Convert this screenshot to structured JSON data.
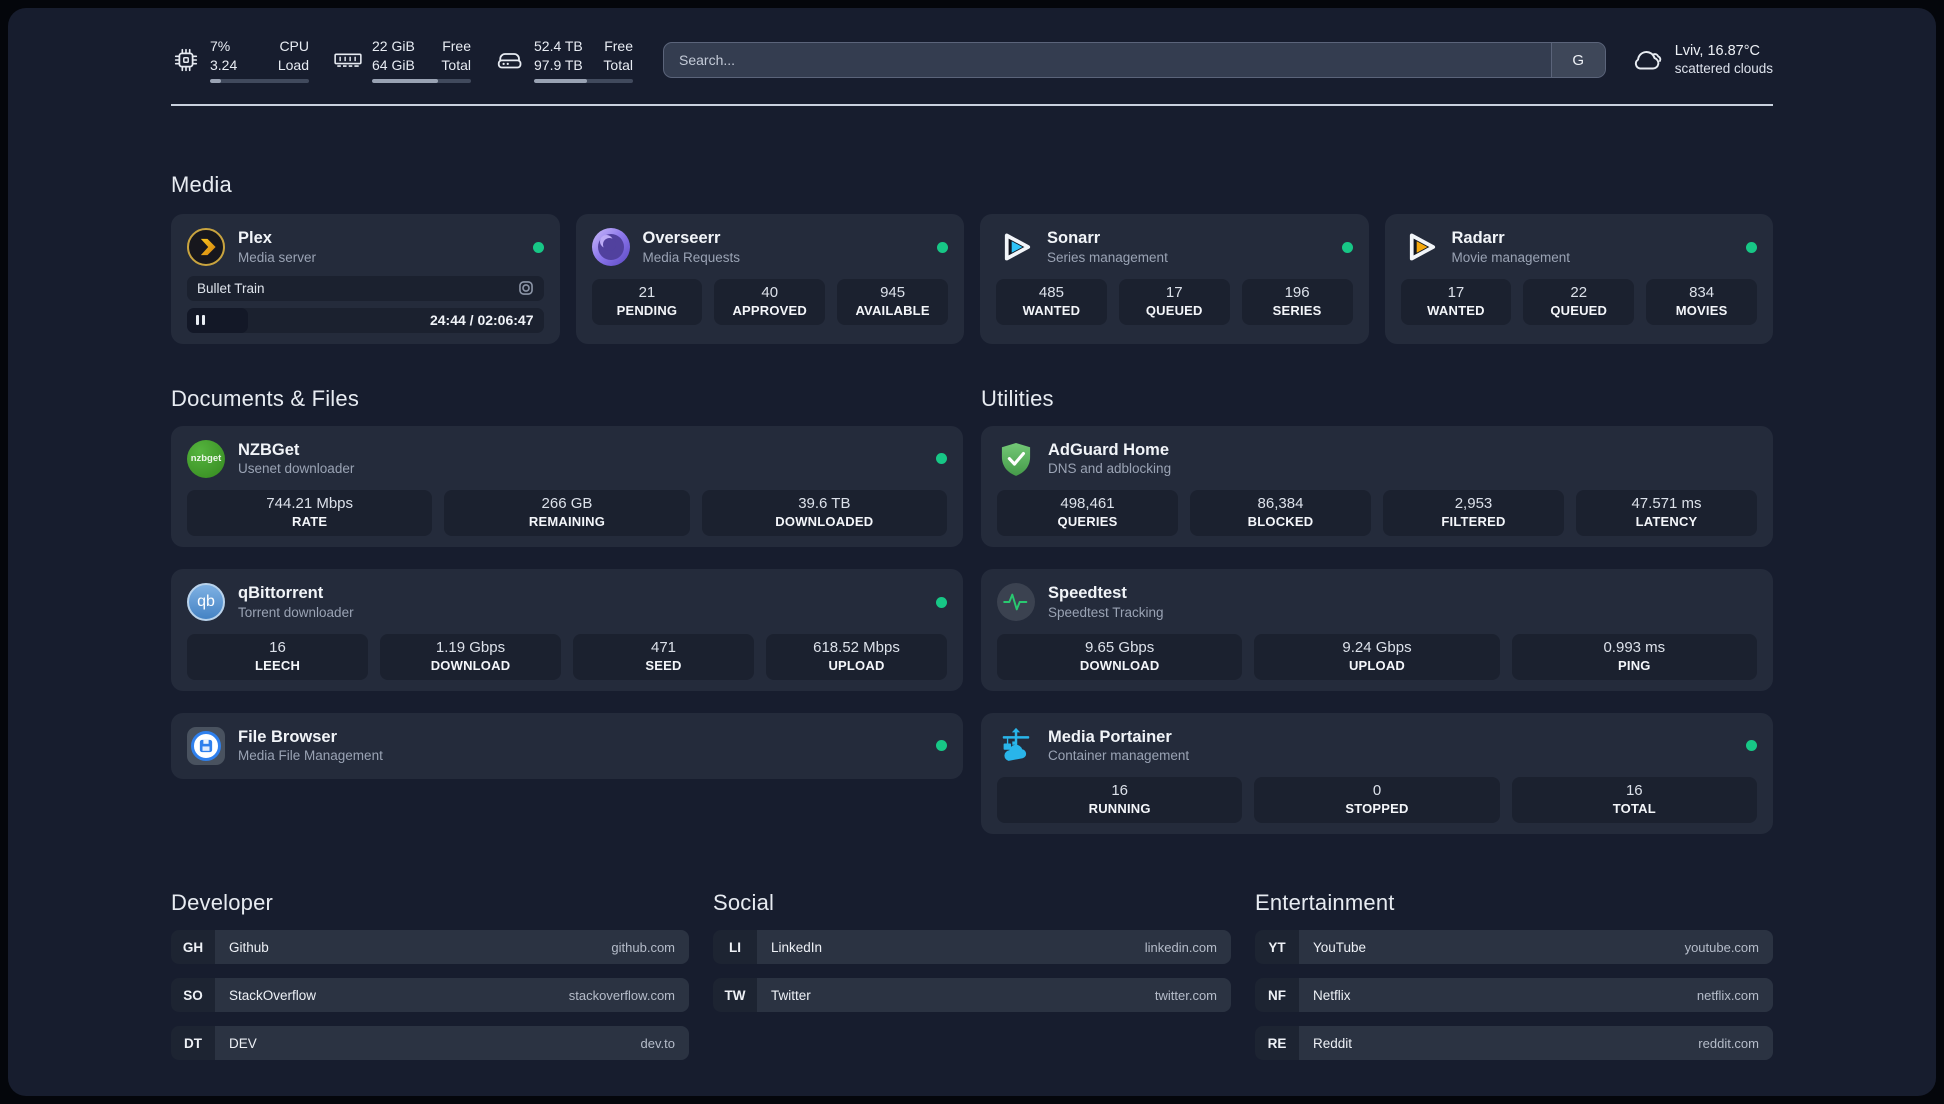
{
  "topbar": {
    "cpu": {
      "value_top": "7%",
      "value_bottom": "3.24",
      "label_top": "CPU",
      "label_bottom": "Load",
      "bar_css": "width:11%"
    },
    "memory": {
      "value_top": "22 GiB",
      "value_bottom": "64 GiB",
      "label_top": "Free",
      "label_bottom": "Total",
      "bar_css": "width:67%"
    },
    "disk": {
      "value_top": "52.4 TB",
      "value_bottom": "97.9 TB",
      "label_top": "Free",
      "label_bottom": "Total",
      "bar_css": "width:54%"
    },
    "search": {
      "placeholder": "Search...",
      "button_label": "G"
    },
    "weather": {
      "line1": "Lviv, 16.87°C",
      "line2": "scattered clouds"
    }
  },
  "media": {
    "header": "Media",
    "plex": {
      "title": "Plex",
      "subtitle": "Media server",
      "now_playing": "Bullet Train",
      "time": "24:44 / 02:06:47",
      "elapsed_css": "width:17%"
    },
    "overseerr": {
      "title": "Overseerr",
      "subtitle": "Media Requests",
      "stats": [
        {
          "value": "21",
          "label": "PENDING"
        },
        {
          "value": "40",
          "label": "APPROVED"
        },
        {
          "value": "945",
          "label": "AVAILABLE"
        }
      ]
    },
    "sonarr": {
      "title": "Sonarr",
      "subtitle": "Series management",
      "stats": [
        {
          "value": "485",
          "label": "WANTED"
        },
        {
          "value": "17",
          "label": "QUEUED"
        },
        {
          "value": "196",
          "label": "SERIES"
        }
      ]
    },
    "radarr": {
      "title": "Radarr",
      "subtitle": "Movie management",
      "stats": [
        {
          "value": "17",
          "label": "WANTED"
        },
        {
          "value": "22",
          "label": "QUEUED"
        },
        {
          "value": "834",
          "label": "MOVIES"
        }
      ]
    }
  },
  "documents": {
    "header": "Documents & Files",
    "nzbget": {
      "title": "NZBGet",
      "subtitle": "Usenet downloader",
      "stats": [
        {
          "value": "744.21 Mbps",
          "label": "RATE"
        },
        {
          "value": "266 GB",
          "label": "REMAINING"
        },
        {
          "value": "39.6 TB",
          "label": "DOWNLOADED"
        }
      ]
    },
    "qbittorrent": {
      "title": "qBittorrent",
      "subtitle": "Torrent downloader",
      "stats": [
        {
          "value": "16",
          "label": "LEECH"
        },
        {
          "value": "1.19 Gbps",
          "label": "DOWNLOAD"
        },
        {
          "value": "471",
          "label": "SEED"
        },
        {
          "value": "618.52 Mbps",
          "label": "UPLOAD"
        }
      ]
    },
    "filebrowser": {
      "title": "File Browser",
      "subtitle": "Media File Management"
    }
  },
  "utilities": {
    "header": "Utilities",
    "adguard": {
      "title": "AdGuard Home",
      "subtitle": "DNS and adblocking",
      "stats": [
        {
          "value": "498,461",
          "label": "QUERIES"
        },
        {
          "value": "86,384",
          "label": "BLOCKED"
        },
        {
          "value": "2,953",
          "label": "FILTERED"
        },
        {
          "value": "47.571 ms",
          "label": "LATENCY"
        }
      ]
    },
    "speedtest": {
      "title": "Speedtest",
      "subtitle": "Speedtest Tracking",
      "stats": [
        {
          "value": "9.65 Gbps",
          "label": "DOWNLOAD"
        },
        {
          "value": "9.24 Gbps",
          "label": "UPLOAD"
        },
        {
          "value": "0.993 ms",
          "label": "PING"
        }
      ]
    },
    "portainer": {
      "title": "Media Portainer",
      "subtitle": "Container management",
      "stats": [
        {
          "value": "16",
          "label": "RUNNING"
        },
        {
          "value": "0",
          "label": "STOPPED"
        },
        {
          "value": "16",
          "label": "TOTAL"
        }
      ]
    }
  },
  "bookmarks": {
    "developer": {
      "header": "Developer",
      "items": [
        {
          "abbr": "GH",
          "name": "Github",
          "url": "github.com"
        },
        {
          "abbr": "SO",
          "name": "StackOverflow",
          "url": "stackoverflow.com"
        },
        {
          "abbr": "DT",
          "name": "DEV",
          "url": "dev.to"
        }
      ]
    },
    "social": {
      "header": "Social",
      "items": [
        {
          "abbr": "LI",
          "name": "LinkedIn",
          "url": "linkedin.com"
        },
        {
          "abbr": "TW",
          "name": "Twitter",
          "url": "twitter.com"
        }
      ]
    },
    "entertainment": {
      "header": "Entertainment",
      "items": [
        {
          "abbr": "YT",
          "name": "YouTube",
          "url": "youtube.com"
        },
        {
          "abbr": "NF",
          "name": "Netflix",
          "url": "netflix.com"
        },
        {
          "abbr": "RE",
          "name": "Reddit",
          "url": "reddit.com"
        }
      ]
    }
  },
  "icon_labels": {
    "nzbget": "nzbget",
    "qbittorrent": "qb"
  },
  "colors": {
    "status_green": "#17c786",
    "plex_gold": "#e8a023",
    "sonarr_blue": "#2fc3f7",
    "radarr_orange": "#f5a80c",
    "adguard_green": "#57b45c",
    "portainer_blue": "#29b5ea",
    "nzbget_green": "#3ba32a",
    "qbittorrent_blue": "#4a8fd0",
    "overseerr_purple": "#7c66dd"
  }
}
